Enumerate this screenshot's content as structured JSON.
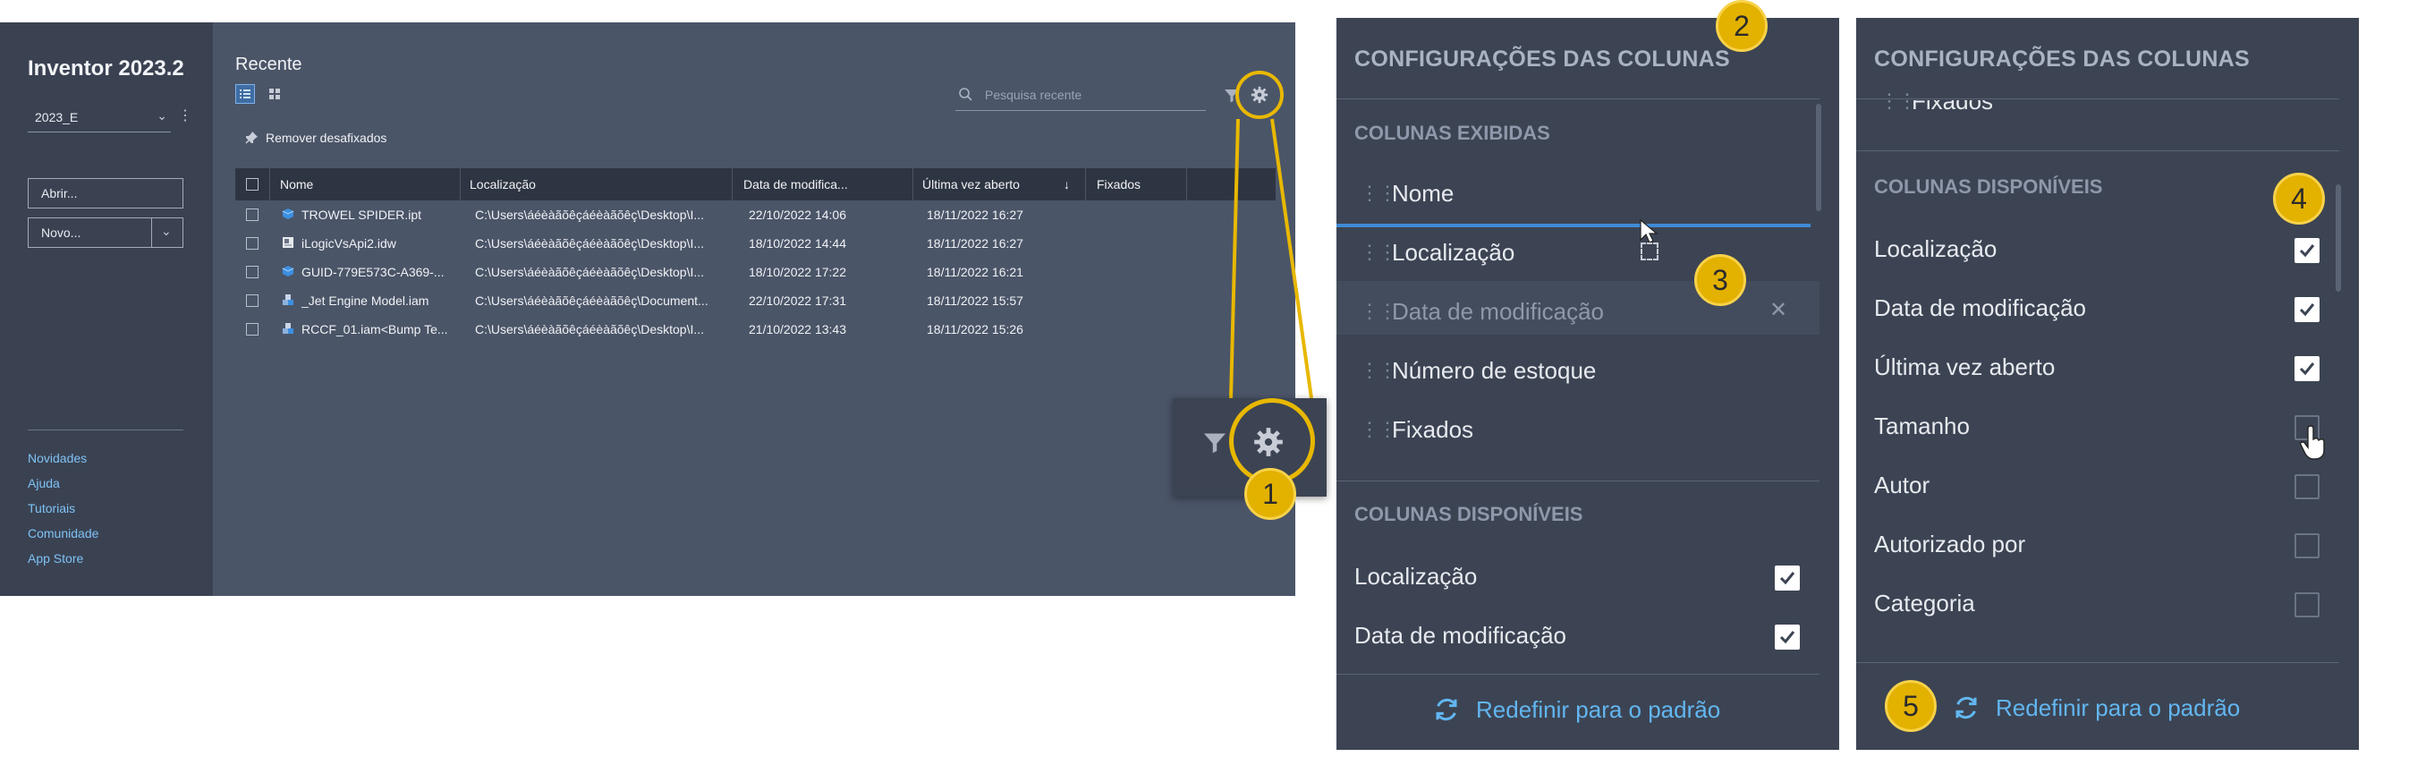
{
  "app": {
    "title": "Inventor 2023.2",
    "project": "2023_E",
    "open_label": "Abrir...",
    "new_label": "Novo..."
  },
  "sidebar_links": [
    "Novidades",
    "Ajuda",
    "Tutoriais",
    "Comunidade",
    "App Store"
  ],
  "recent": {
    "title": "Recente",
    "search_placeholder": "Pesquisa recente",
    "remove_unpinned": "Remover desafixados",
    "columns": [
      "Nome",
      "Localização",
      "Data de modifica...",
      "Última vez aberto",
      "Fixados"
    ],
    "sort_indicator": "↓",
    "rows": [
      {
        "icon": "part-icon",
        "name": "TROWEL SPIDER.ipt",
        "location": "C:\\Users\\áéèàãõêçáéèàãõêç\\Desktop\\I...",
        "modified": "22/10/2022 14:06",
        "opened": "18/11/2022 16:27"
      },
      {
        "icon": "drawing-icon",
        "name": "iLogicVsApi2.idw",
        "location": "C:\\Users\\áéèàãõêçáéèàãõêç\\Desktop\\I...",
        "modified": "18/10/2022 14:44",
        "opened": "18/11/2022 16:27"
      },
      {
        "icon": "part-icon",
        "name": "GUID-779E573C-A369-...",
        "location": "C:\\Users\\áéèàãõêçáéèàãõêç\\Desktop\\I...",
        "modified": "18/10/2022 17:22",
        "opened": "18/11/2022 16:21"
      },
      {
        "icon": "assembly-icon",
        "name": "_Jet Engine Model.iam",
        "location": "C:\\Users\\áéèàãõêçáéèàãõêç\\Document...",
        "modified": "22/10/2022 17:31",
        "opened": "18/11/2022 15:57"
      },
      {
        "icon": "assembly-icon",
        "name": "RCCF_01.iam<Bump Te...",
        "location": "C:\\Users\\áéèàãõêçáéèàãõêç\\Desktop\\I...",
        "modified": "21/10/2022 13:43",
        "opened": "18/11/2022 15:26"
      }
    ]
  },
  "panel_left": {
    "title": "CONFIGURAÇÕES DAS COLUNAS",
    "displayed_section": "COLUNAS EXIBIDAS",
    "displayed": [
      "Nome",
      "Localização",
      "Data de modificação",
      "Número de estoque",
      "Fixados"
    ],
    "available_section": "COLUNAS DISPONÍVEIS",
    "available": [
      {
        "label": "Localização",
        "checked": true
      },
      {
        "label": "Data de modificação",
        "checked": true
      }
    ],
    "reset_label": "Redefinir para o padrão"
  },
  "panel_right": {
    "title": "CONFIGURAÇÕES DAS COLUNAS",
    "pinned_item": "Fixados",
    "available_section": "COLUNAS DISPONÍVEIS",
    "available": [
      {
        "label": "Localização",
        "checked": true
      },
      {
        "label": "Data de modificação",
        "checked": true
      },
      {
        "label": "Última vez aberto",
        "checked": true
      },
      {
        "label": "Tamanho",
        "checked": false
      },
      {
        "label": "Autor",
        "checked": false
      },
      {
        "label": "Autorizado por",
        "checked": false
      },
      {
        "label": "Categoria",
        "checked": false
      }
    ],
    "reset_label": "Redefinir para o padrão"
  },
  "badges": [
    "1",
    "2",
    "3",
    "4",
    "5"
  ],
  "colors": {
    "highlight": "#e8b800",
    "accent_link": "#62b6f0",
    "panel_bg": "#3c4453"
  }
}
